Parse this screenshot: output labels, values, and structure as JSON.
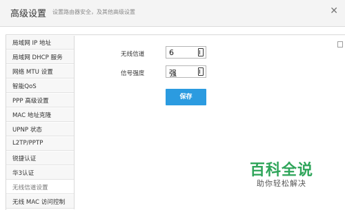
{
  "header": {
    "title": "高级设置",
    "subtitle": "设置路由器安全，及其他高级设置",
    "close_icon": "close-icon"
  },
  "sidebar": {
    "items": [
      {
        "label": "局域网 IP 地址"
      },
      {
        "label": "局域网 DHCP 服务"
      },
      {
        "label": "网络 MTU 设置"
      },
      {
        "label": "智能QoS"
      },
      {
        "label": "PPP 高级设置"
      },
      {
        "label": "MAC 地址克隆"
      },
      {
        "label": "UPNP 状态"
      },
      {
        "label": "L2TP/PPTP"
      },
      {
        "label": "锐捷认证"
      },
      {
        "label": "华3认证"
      },
      {
        "label": "无线信道设置",
        "active": true
      },
      {
        "label": "无线 MAC 访问控制"
      }
    ]
  },
  "form": {
    "channel": {
      "label": "无线信道",
      "value": "6"
    },
    "signal": {
      "label": "信号强度",
      "value": "强"
    },
    "save_label": "保存"
  },
  "watermark": {
    "title": "百科全说",
    "subtitle": "助你轻松解决"
  },
  "colors": {
    "accent": "#2b9be0",
    "watermark": "#2fa55a"
  }
}
